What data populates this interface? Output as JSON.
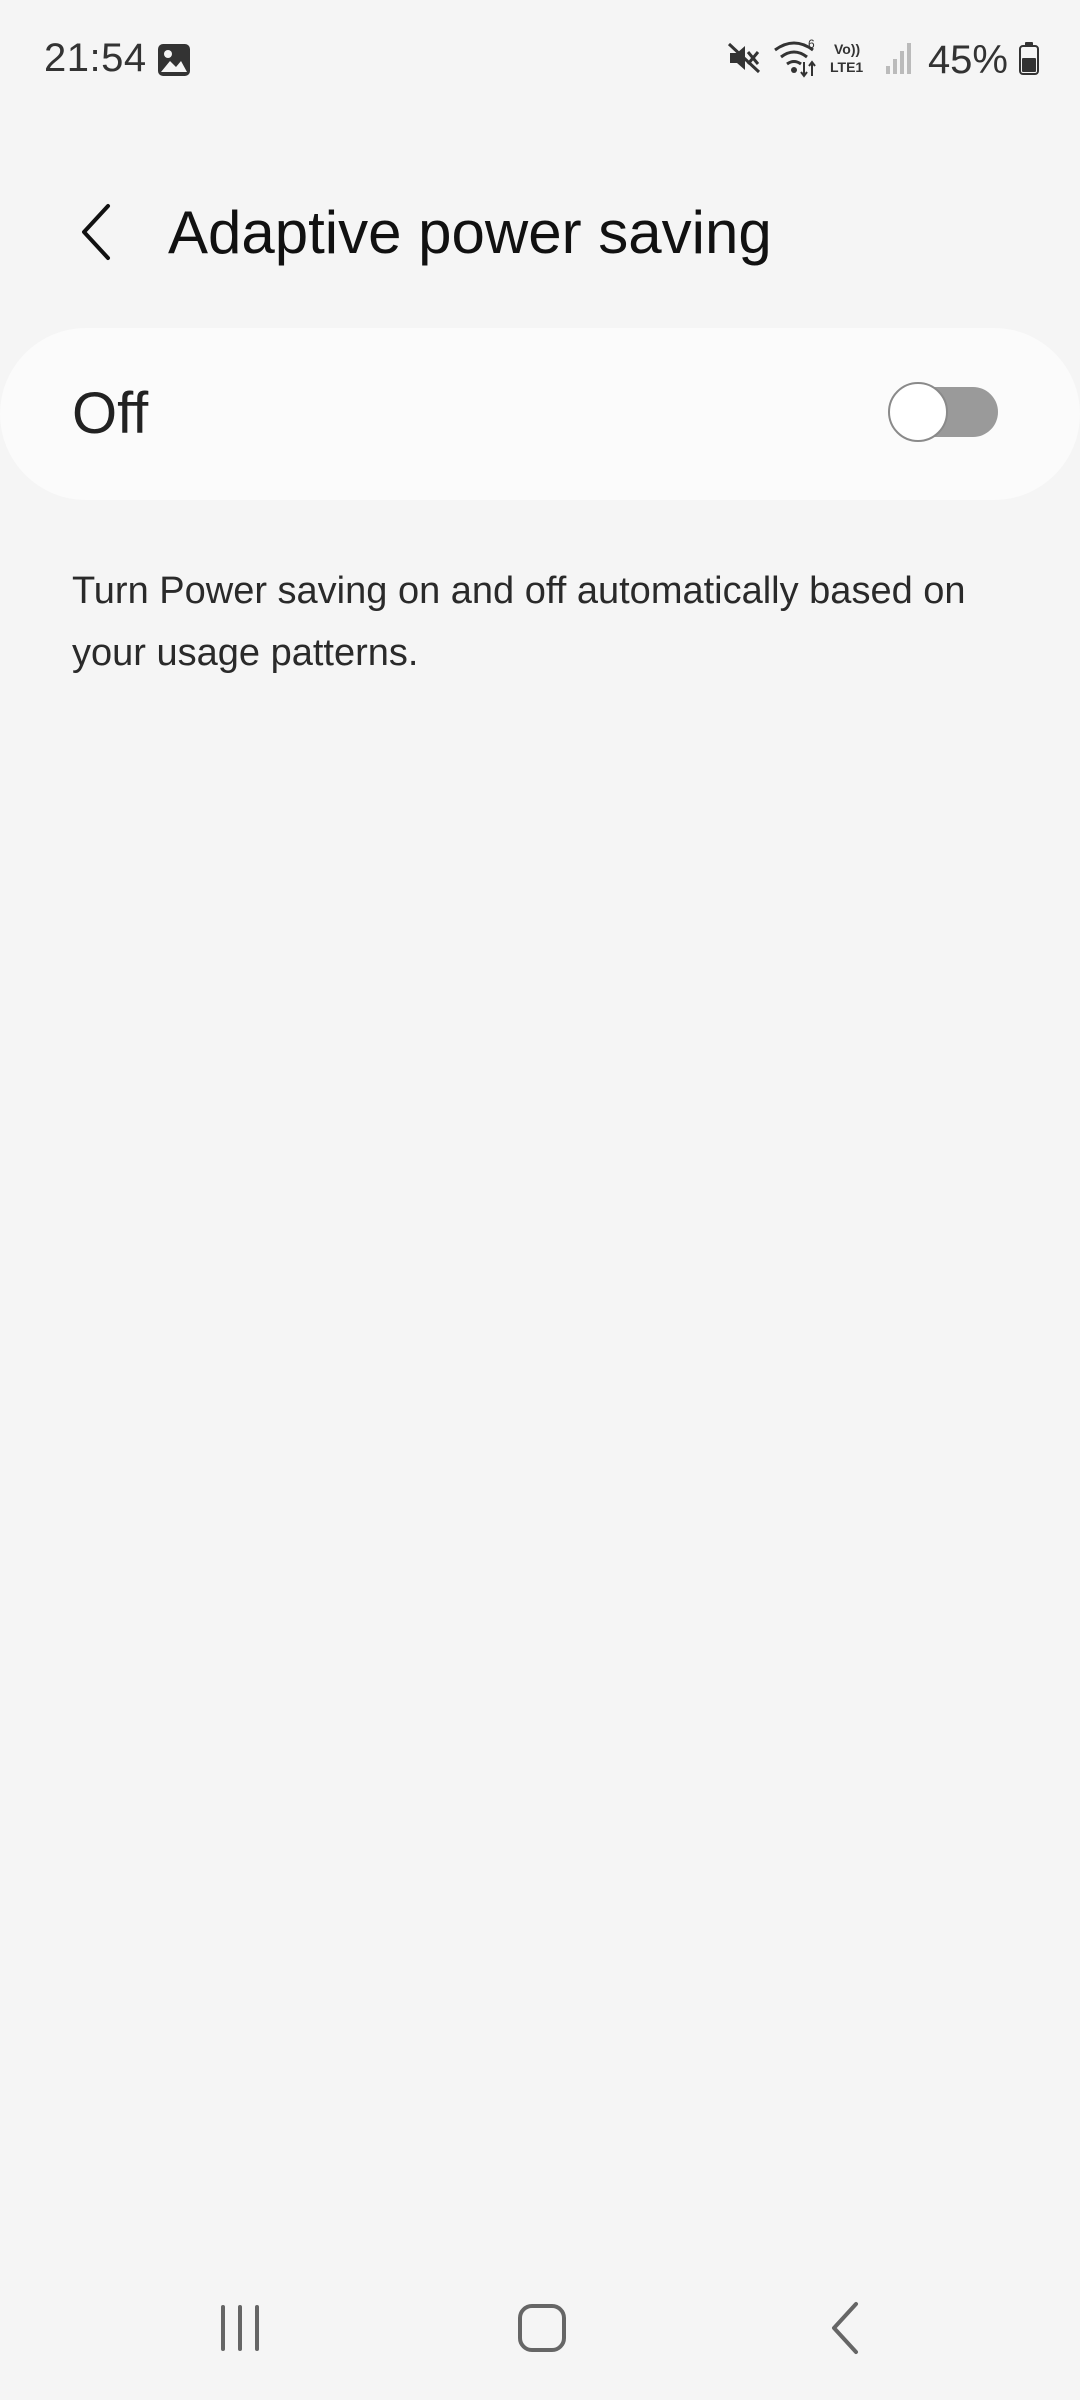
{
  "status_bar": {
    "time": "21:54",
    "battery_percent": "45%",
    "icons": [
      "gallery-icon",
      "mute-icon",
      "wifi-icon",
      "volte-lte-icon",
      "signal-icon",
      "battery-icon"
    ]
  },
  "header": {
    "title": "Adaptive power saving",
    "back_icon": "chevron-left-icon"
  },
  "master_toggle": {
    "label": "Off",
    "state": false
  },
  "description": "Turn Power saving on and off automatically based on your usage patterns.",
  "nav_bar": {
    "items": [
      "recents-icon",
      "home-icon",
      "back-icon"
    ]
  },
  "colors": {
    "background": "#f5f5f5",
    "card": "#fbfbfb",
    "switch_track_off": "#9a9a9a"
  }
}
